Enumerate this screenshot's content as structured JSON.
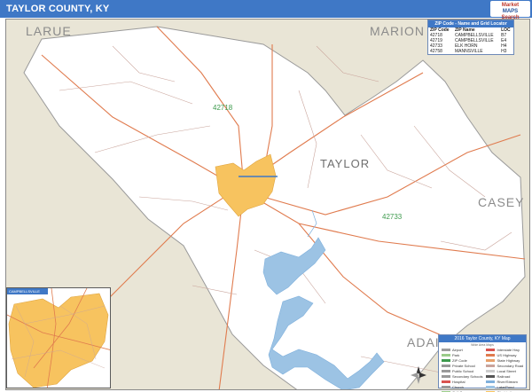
{
  "header": {
    "title": "TAYLOR COUNTY, KY",
    "brand_line1": "Market",
    "brand_line2": "MAPS",
    "brand_line3": "Search"
  },
  "map": {
    "neighbors": [
      "LARUE",
      "MARION",
      "CASEY",
      "ADAIR"
    ],
    "county_name": "TAYLOR",
    "road_labels": [
      "42718"
    ],
    "zip_labels": [
      "42733"
    ],
    "colors": {
      "background": "#e9e5d6",
      "county_fill": "#ffffff",
      "city_fill": "#f7c35f",
      "lake_fill": "#9cc3e4",
      "major_road": "#e07b4e",
      "minor_road": "#c9a49b",
      "title_bar": "#3f78c6"
    }
  },
  "zip_table": {
    "title": "ZIP Code - Name and Grid Locator",
    "headers": [
      "ZIP Code",
      "ZIP Name",
      "LOC"
    ],
    "rows": [
      [
        "42718",
        "CAMPBELLSVILLE",
        "B7"
      ],
      [
        "42719",
        "CAMPBELLSVILLE",
        "E4"
      ],
      [
        "42733",
        "ELK HORN",
        "H4"
      ],
      [
        "42758",
        "MANNSVILLE",
        "H3"
      ]
    ]
  },
  "inset": {
    "title": "CAMPBELLSVILLE"
  },
  "legend": {
    "title": "2016 Taylor County, KY Map",
    "subtitle": "Wide Area Maps",
    "items": [
      {
        "label": "Airport",
        "color": "#9e9e9e"
      },
      {
        "label": "Interstate Hwy",
        "color": "#d9534f"
      },
      {
        "label": "Park",
        "color": "#9bcc8a"
      },
      {
        "label": "US Highway",
        "color": "#e07b4e"
      },
      {
        "label": "ZIP Code",
        "color": "#3d9a4d"
      },
      {
        "label": "State Highway",
        "color": "#e8a06a"
      },
      {
        "label": "Private School",
        "color": "#999999"
      },
      {
        "label": "Secondary Road",
        "color": "#c9a49b"
      },
      {
        "label": "Public School",
        "color": "#999999"
      },
      {
        "label": "Local Street",
        "color": "#cccccc"
      },
      {
        "label": "Secondary Schools",
        "color": "#999999"
      },
      {
        "label": "Railroad",
        "color": "#555555"
      },
      {
        "label": "Hospital",
        "color": "#d9534f"
      },
      {
        "label": "River/Stream",
        "color": "#7fb0dc"
      },
      {
        "label": "Church",
        "color": "#999999"
      },
      {
        "label": "Lake/Pond",
        "color": "#9cc3e4"
      },
      {
        "label": "Golf Course",
        "color": "#9bcc8a"
      },
      {
        "label": "City Limits",
        "color": "#f7c35f"
      },
      {
        "label": "Cemetery",
        "color": "#999999"
      },
      {
        "label": "County Boundary",
        "color": "#888888"
      }
    ]
  }
}
